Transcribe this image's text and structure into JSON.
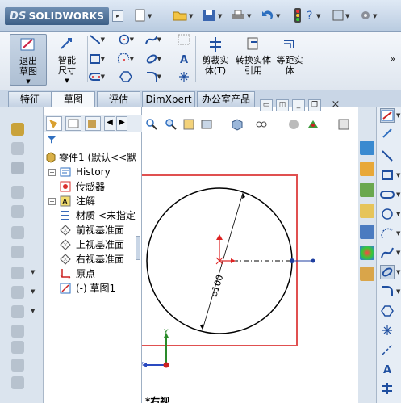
{
  "app": {
    "logo_ds": "DS",
    "logo_text": "SOLIDWORKS"
  },
  "menubar": {
    "icons": [
      "new-document-icon",
      "open-folder-icon",
      "save-icon",
      "print-icon",
      "undo-icon",
      "rebuild-traffic-light-icon",
      "help-icon",
      "view-icon",
      "options-gear-icon"
    ]
  },
  "command_manager": {
    "exit_sketch_label": "退出草图",
    "smart_dimension_label": "智能尺寸",
    "trim_label": "剪裁实体(T)",
    "convert_label": "转换实体引用",
    "offset_label": "等距实体",
    "sketch_tools": [
      "line-icon",
      "circle-icon",
      "spline-icon",
      "rectangle-icon",
      "arc-icon",
      "ellipse-icon",
      "slot-icon",
      "polygon-icon",
      "fillet-icon",
      "grid-icon",
      "text-icon",
      "point-icon"
    ]
  },
  "tabs": [
    {
      "label": "特征"
    },
    {
      "label": "草图"
    },
    {
      "label": "评估"
    },
    {
      "label": "DimXpert"
    },
    {
      "label": "办公室产品"
    }
  ],
  "feature_tree": {
    "root": "零件1 (默认<<默",
    "items": [
      {
        "label": "History",
        "icon": "history-icon"
      },
      {
        "label": "传感器",
        "icon": "sensor-icon"
      },
      {
        "label": "注解",
        "icon": "annotation-icon"
      },
      {
        "label": "材质 <未指定",
        "icon": "material-icon"
      },
      {
        "label": "前视基准面",
        "icon": "plane-icon"
      },
      {
        "label": "上视基准面",
        "icon": "plane-icon"
      },
      {
        "label": "右视基准面",
        "icon": "plane-icon"
      },
      {
        "label": "原点",
        "icon": "origin-icon"
      },
      {
        "label": "(-) 草图1",
        "icon": "sketch-icon"
      }
    ]
  },
  "graphics": {
    "dimension_text": "⌀100",
    "axis_y": "Y",
    "axis_z": "Z",
    "view_label": "*右视",
    "highlight_color": "#e05050"
  }
}
